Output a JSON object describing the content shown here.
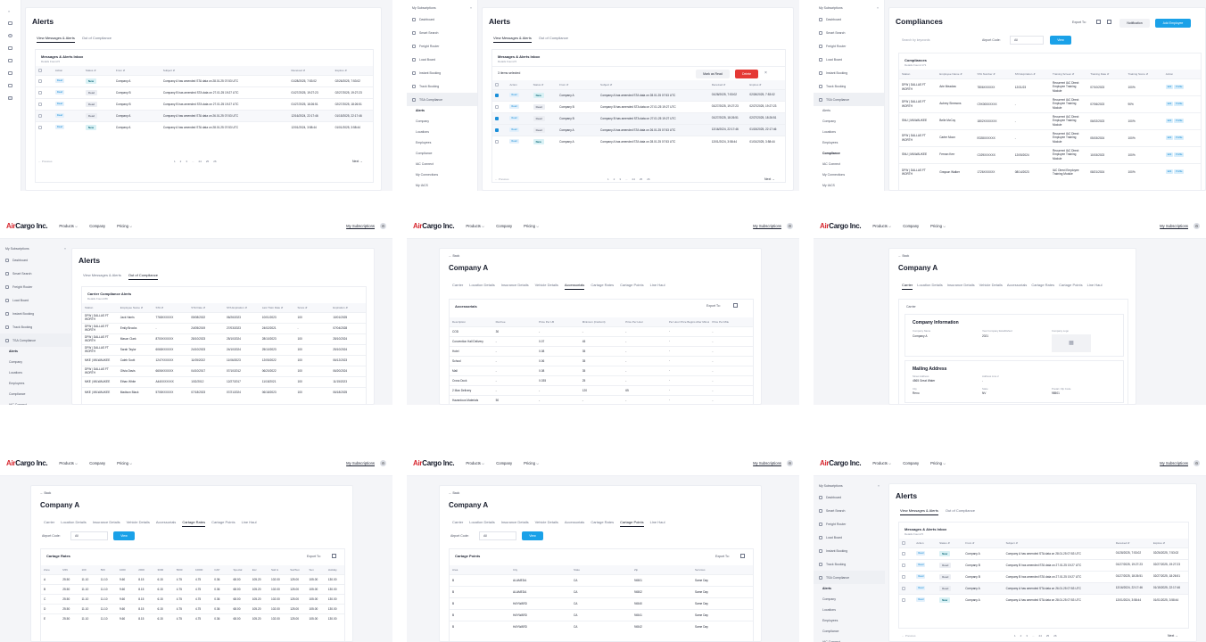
{
  "app": {
    "logo_prefix": "Air",
    "logo_suffix": "Cargo Inc.",
    "nav": [
      "Products ⌵",
      "Company",
      "Pricing ⌵"
    ],
    "my_subscriptions": "My Subscriptions"
  },
  "sidebar": {
    "header": "My Subscriptions",
    "items": [
      "Dashboard",
      "Smart Search",
      "Freight Router",
      "Load Board",
      "Instant Booking",
      "Track Booking",
      "TSA Compliance"
    ],
    "subitems": [
      "Alerts",
      "Company",
      "Locations",
      "Employees",
      "Compliance",
      "IAC Connect",
      "My Connections",
      "My IACS"
    ]
  },
  "alerts": {
    "title": "Alerts",
    "tab_messages": "View Messages & Alerts",
    "tab_ooc": "Out of Compliance",
    "inbox_title": "Messages & Alerts Inbox",
    "details_found": "Details Found 5",
    "items_selected": "3 items selected",
    "mark_as_read": "Mark as Read",
    "delete": "Delete",
    "columns": [
      "Action",
      "Status ⇵",
      "From ⇵",
      "Subject ⇵",
      "Received ⇵",
      "Expires ⇵"
    ],
    "rows": [
      {
        "action": "Read",
        "status": "New",
        "from": "Company A",
        "subject": "Company A has amended STA data on 28.01.25 07:53 UTC",
        "received": "01/28/2025, 7:53:02",
        "expires": "02/26/2025, 7:53:02"
      },
      {
        "action": "Read",
        "status": "Read",
        "from": "Company B",
        "subject": "Company B has amended STA data on 27.01.25 19:27 UTC",
        "received": "01/27/2025, 19:27:23",
        "expires": "02/27/2025, 19:27:23"
      },
      {
        "action": "Read",
        "status": "Read",
        "from": "Company B",
        "subject": "Company B has amended STA data on 27.01.25 19:27 UTC",
        "received": "01/27/2025, 18:26:51",
        "expires": "02/27/2025, 18:26:51"
      },
      {
        "action": "Read",
        "status": "Read",
        "from": "Company A",
        "subject": "Company A has amended STA data on 26.01.25 07:53 UTC",
        "received": "12/16/2024, 22:17:46",
        "expires": "01/15/2025, 22:17:46"
      },
      {
        "action": "Read",
        "status": "New",
        "from": "Company A",
        "subject": "Company A has amended STA data on 28.01.25 07:53 UTC",
        "received": "12/01/2024, 3:58:44",
        "expires": "01/01/2025, 3:58:44"
      }
    ],
    "pages": [
      "1",
      "2",
      "3",
      "...",
      "24",
      "25",
      "26"
    ],
    "previous": "← Previous",
    "next": "Next →"
  },
  "compliances": {
    "title": "Compliances",
    "export_to": "Export To:",
    "notification": "Notification",
    "add_employee": "Add Employee",
    "search_placeholder": "Search by keywords",
    "airport_code": "Airport Code:",
    "airport_value": "All",
    "view": "View",
    "list_title": "Compliances",
    "details_found": "Details Found 171",
    "columns": [
      "Station",
      "Employee Name ⇵",
      "STA Number ⇵",
      "STA Expiration ⇵",
      "Training Screen ⇵",
      "Training Date ⇵",
      "Training Score ⇵",
      "Action"
    ],
    "rows": [
      [
        "DFW | DALLAS FT WORTH",
        "Arie Meadow",
        "7806XXXXXX",
        "12/31/23",
        "Recurrent IAC Direct Employee Training Module",
        "07/10/2023",
        "100%"
      ],
      [
        "DFW | DALLAS FT WORTH",
        "Aubrey Simmons",
        "C9X000XXXXX",
        "-",
        "Recurrent IAC Direct Employee Training Module",
        "07/06/2023",
        "90%"
      ],
      [
        "SNU | MILWAUKEE",
        "Belle McCoy",
        "1802XXXXXXX",
        "-",
        "Recurrent IAC Direct Employee Training Module",
        "06/02/2023",
        "100%"
      ],
      [
        "DFW | DALLAS FT WORTH",
        "Carter Moon",
        "E028XXXXXX",
        "-",
        "Recurrent IAC Direct Employee Training Module",
        "05/15/2024",
        "100%"
      ],
      [
        "SNU | MILWAUKEE",
        "Fernan Kerr",
        "C029XXXXXX",
        "12/05/2024",
        "Recurrent IAC Direct Employee Training Module",
        "10/15/2023",
        "100%"
      ],
      [
        "DFW | DALLAS FT WORTH",
        "Grayson Walker",
        "1726XXXXXX",
        "08/14/2023",
        "IAC Direct Employee Training Module",
        "08/21/2024",
        "100%"
      ]
    ],
    "edit": "Edit",
    "profile": "Profile"
  },
  "carrier_compliance": {
    "title": "Alerts",
    "list_title": "Carrier Compliance Alerts",
    "details_found": "Details Found 89",
    "columns": [
      "Station",
      "Employee Name ⇵",
      "STA ⇵",
      "STA Date ⇵",
      "STA Expiration ⇵",
      "Last Train Date ⇵",
      "Score ⇵",
      "Expiration ⇵"
    ],
    "rows": [
      [
        "DFW | DALLAS FT WORTH",
        "Jack Harris",
        "7768XXXXXX",
        "05/08/2022",
        "06/26/2023",
        "10/01/2023",
        "100",
        "10/01/2025"
      ],
      [
        "DFW | DALLAS FT WORTH",
        "Emily Brooks",
        "-",
        "24/05/2019",
        "27/03/2023",
        "24/02/2021",
        "-",
        "07/04/2028"
      ],
      [
        "DFW | DALLAS FT WORTH",
        "Mason Clark",
        "8700XXXXXX",
        "28/10/2023",
        "25/10/2024",
        "28/10/2023",
        "100",
        "28/10/2024"
      ],
      [
        "DFW | DALLAS FT WORTH",
        "Sarah Taylor",
        "6068XXXXXX",
        "24/10/2023",
        "24/10/2024",
        "25/10/2023",
        "100",
        "25/10/2024"
      ],
      [
        "MKE | MILWAUKEE",
        "Caleb Scott",
        "1247XXXXXX",
        "11/05/2022",
        "11/06/2023",
        "12/05/2022",
        "100",
        "06/12/2023"
      ],
      [
        "DFW | DALLAS FT WORTH",
        "Olivia Davis",
        "6606XXXXXX",
        "04/10/2017",
        "07/10/2012",
        "06/20/2022",
        "100",
        "06/20/2024"
      ],
      [
        "MKE | MILWAUKEE",
        "Ethan White",
        "A440XXXXXX",
        "1/02/2012",
        "12/27/2017",
        "11/15/2021",
        "100",
        "11/15/2023"
      ],
      [
        "MKE | MILWAUKEE",
        "Madison Black",
        "5708XXXXXX",
        "07/18/2023",
        "07/21/2024",
        "06/18/2023",
        "100",
        "06/18/2025"
      ]
    ]
  },
  "company": {
    "back": "← Back",
    "title": "Company A",
    "tabs": [
      "Carrier",
      "Location Details",
      "Insurance Details",
      "Vehicle Details",
      "Accessorials",
      "Cartage Rates",
      "Cartage Points",
      "Line Haul"
    ],
    "accessorials": {
      "title": "Accessorials",
      "export_to": "Export To:",
      "columns": [
        "Description",
        "Flat Fee",
        "Price Per LB",
        "Minimum (Cwt/unit)",
        "Price Per Hour",
        "Per Hour Price Begins After Minutes",
        "Price Per Mile"
      ],
      "rows": [
        [
          "COD",
          "30",
          "-",
          "-",
          "-",
          "-",
          "-"
        ],
        [
          "Convention Hall Delivery",
          "-",
          "0.07",
          "45",
          "-",
          "-",
          "-"
        ],
        [
          "Hotel",
          "-",
          "0.08",
          "35",
          "-",
          "-",
          "-"
        ],
        [
          "School",
          "-",
          "0.06",
          "35",
          "-",
          "-",
          "-"
        ],
        [
          "Mall",
          "-",
          "0.08",
          "35",
          "-",
          "-",
          "-"
        ],
        [
          "Cross Dock",
          "-",
          "0.035",
          "25",
          "-",
          "-",
          "-"
        ],
        [
          "2 Man Delivery",
          "-",
          "-",
          "120",
          "65",
          "-",
          "-"
        ],
        [
          "Hazardous Materials",
          "50",
          "-",
          "-",
          "-",
          "-",
          "-"
        ],
        [
          "Lift Gate",
          "40",
          "-",
          "-",
          "-",
          "-",
          "-"
        ]
      ]
    },
    "info": {
      "carrier_label": "Carrier",
      "company_info": "Company Information",
      "company_name_label": "Company Name",
      "company_name": "Company A",
      "established_label": "Year Company Established",
      "established": "2021",
      "logo_label": "Company Logo",
      "mailing": "Mailing Address",
      "street_label": "Street Address",
      "street": "4565 Great Water",
      "addr2_label": "Address Line 2",
      "addr2": "-",
      "city_label": "City",
      "city": "Reno",
      "state_label": "State",
      "state": "NV",
      "zip_label": "Postal / Zip Code",
      "zip": "98501",
      "billing": "Billing Address"
    },
    "airport_code": "Airport Code:",
    "airport_value": "All",
    "view": "View",
    "cartage_rates": {
      "title": "Cartage Rates",
      "export_to": "Export To:",
      "columns": [
        "Zone",
        "MIN",
        "100",
        "500",
        "1000",
        "2000",
        "3000",
        "5000",
        "10000",
        "CAP",
        "Special",
        "Exc",
        "Satl &",
        "Sat/Sun",
        "Sun",
        "Holiday"
      ],
      "rows": [
        [
          "A",
          "25.50",
          "11.10",
          "11.10",
          "9.60",
          "8.15",
          "6.15",
          "4.75",
          "4.75",
          "0.36",
          "68.00",
          "105.20",
          "102.00",
          "125.00",
          "105.00",
          "130.00"
        ],
        [
          "B",
          "25.50",
          "11.10",
          "11.10",
          "9.60",
          "8.15",
          "6.15",
          "4.75",
          "4.75",
          "0.36",
          "68.00",
          "105.20",
          "102.00",
          "125.00",
          "105.00",
          "130.00"
        ],
        [
          "C",
          "25.50",
          "11.10",
          "11.10",
          "9.60",
          "8.15",
          "6.15",
          "4.75",
          "4.75",
          "0.36",
          "68.00",
          "105.20",
          "102.00",
          "125.00",
          "105.00",
          "130.00"
        ],
        [
          "D",
          "25.50",
          "11.10",
          "11.10",
          "9.60",
          "8.15",
          "6.15",
          "4.75",
          "4.75",
          "0.36",
          "68.00",
          "105.20",
          "102.00",
          "125.00",
          "105.00",
          "130.00"
        ],
        [
          "E",
          "25.50",
          "11.10",
          "11.10",
          "9.60",
          "8.15",
          "6.15",
          "4.75",
          "4.75",
          "0.36",
          "68.00",
          "105.20",
          "102.00",
          "125.00",
          "105.00",
          "130.00"
        ]
      ]
    },
    "cartage_points": {
      "title": "Cartage Points",
      "export_to": "Export To:",
      "columns": [
        "Area",
        "City",
        "State",
        "Zip",
        "Services"
      ],
      "rows": [
        [
          "B",
          "ALAMEDA",
          "CA",
          "94501",
          "Same Day"
        ],
        [
          "B",
          "ALAMEDA",
          "CA",
          "94502",
          "Same Day"
        ],
        [
          "B",
          "HAYWARD",
          "CA",
          "94540",
          "Same Day"
        ],
        [
          "B",
          "HAYWARD",
          "CA",
          "94541",
          "Same Day"
        ],
        [
          "B",
          "HAYWARD",
          "CA",
          "94542",
          "Same Day"
        ]
      ]
    }
  }
}
